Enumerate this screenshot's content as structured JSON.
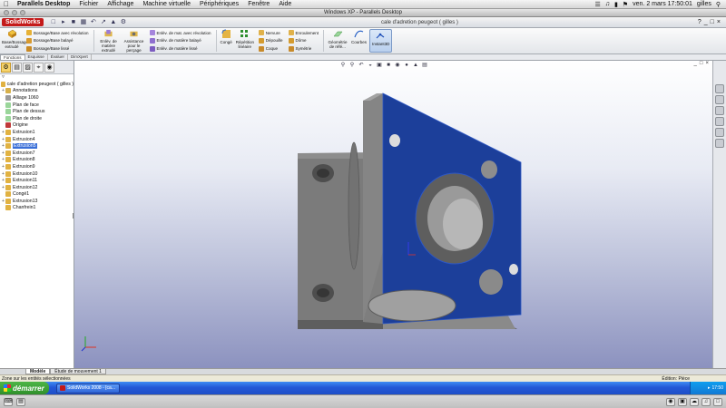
{
  "mac_menu": {
    "app": "Parallels Desktop",
    "items": [
      "Fichier",
      "Affichage",
      "Machine virtuelle",
      "Périphériques",
      "Fenêtre",
      "Aide"
    ],
    "clock": "ven. 2 mars  17:50:01",
    "user": "gilles"
  },
  "window_title": "Windows XP - Parallels Desktop",
  "sw": {
    "logo": "SolidWorks",
    "doc_title": "cale d'adretion peugeot ( gilles )"
  },
  "command_manager": {
    "base_extrude": "Base/Bossage extrudé",
    "list1": [
      "Bossage/Base avec révolution",
      "Bossage/Base balayé",
      "Bossage/Base lissé"
    ],
    "cut_extrude": "Enlèv. de matière extrudé",
    "hole_wizard": "Assistance pour le perçage",
    "list2": [
      "Enlèv. de mat. avec révolution",
      "Enlèv. de matière balayé",
      "Enlèv. de matière lissé"
    ],
    "fillet": "Congé",
    "linear_pattern": "Répétition linéaire",
    "list3": [
      "Nervure",
      "Dépouille",
      "Coque"
    ],
    "list4": [
      "Enroulement",
      "Dôme",
      "Symétrie"
    ],
    "ref_geometry": "Géométrie de réfé...",
    "curves": "Courbes",
    "instant3d": "Instant3D"
  },
  "tabs": [
    "Fonctions",
    "Esquisse",
    "Évaluer",
    "DimXpert"
  ],
  "feature_tree": {
    "root": "cale d'adretion peugeot  ( gilles )",
    "items": [
      {
        "label": "Annotations",
        "expand": "+"
      },
      {
        "label": "Alliage 1060",
        "expand": ""
      },
      {
        "label": "Plan de face",
        "expand": ""
      },
      {
        "label": "Plan de dessus",
        "expand": ""
      },
      {
        "label": "Plan de droite",
        "expand": ""
      },
      {
        "label": "Origine",
        "expand": ""
      },
      {
        "label": "Extrusion1",
        "expand": "+"
      },
      {
        "label": "Extrusion4",
        "expand": "+"
      },
      {
        "label": "Extrusion5",
        "expand": "+"
      },
      {
        "label": "Extrusion7",
        "expand": "+"
      },
      {
        "label": "Extrusion8",
        "expand": "+"
      },
      {
        "label": "Extrusion9",
        "expand": "+"
      },
      {
        "label": "Extrusion10",
        "expand": "+"
      },
      {
        "label": "Extrusion11",
        "expand": "+"
      },
      {
        "label": "Extrusion12",
        "expand": "+"
      },
      {
        "label": "Congé1",
        "expand": ""
      },
      {
        "label": "Extrusion13",
        "expand": "+"
      },
      {
        "label": "Chanfrein1",
        "expand": ""
      }
    ]
  },
  "bottom_tabs": [
    "Modèle",
    "Étude de mouvement 1"
  ],
  "status": {
    "message": "Zone sur les entités sélectionnées",
    "edition": "Édition: Pièce"
  },
  "taskbar": {
    "start": "démarrer",
    "task": "SolidWorks 2008 - [ca...",
    "clock": "17:50"
  },
  "colors": {
    "face_blue": "#1c3f9a",
    "part_grey": "#8c8c8c",
    "sw_red": "#c41a1a"
  }
}
